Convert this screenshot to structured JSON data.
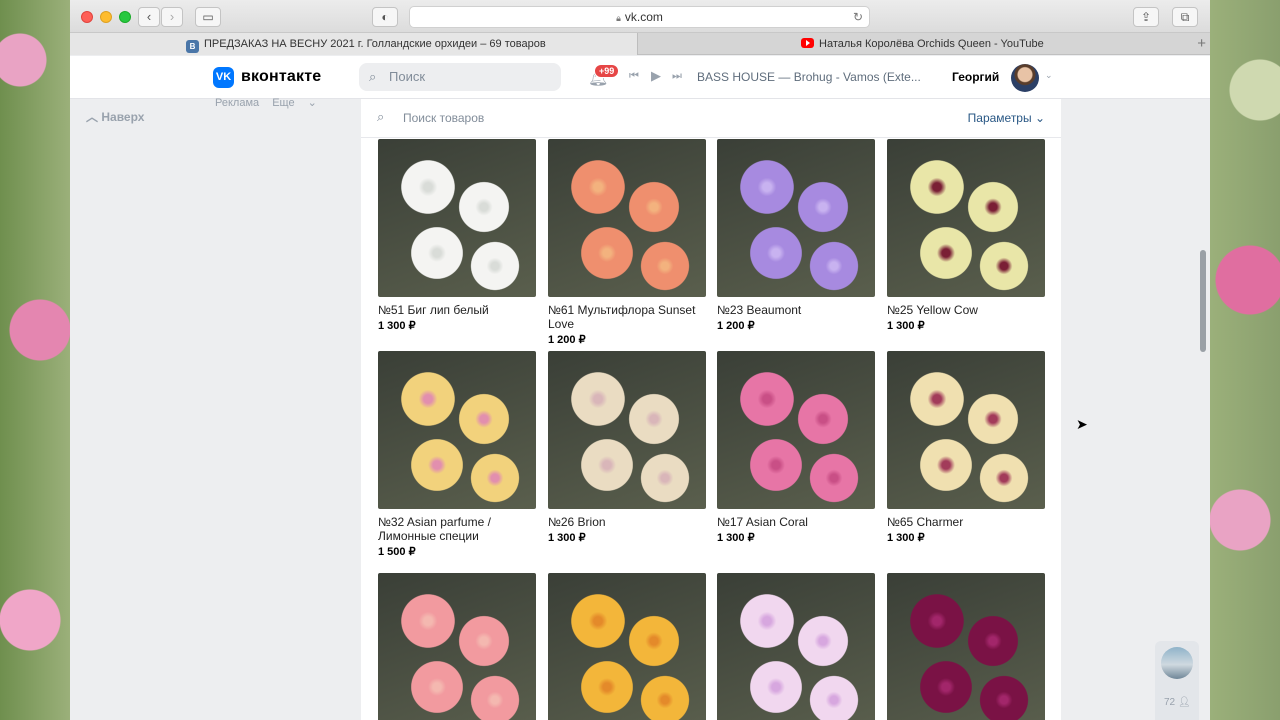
{
  "browser": {
    "url": "vk.com",
    "tabs": [
      {
        "title": "ПРЕДЗАКАЗ НА ВЕСНУ 2021 г. Голландские орхидеи – 69 товаров",
        "favicon": "vk-icon"
      },
      {
        "title": "Наталья Королёва Orchids Queen - YouTube",
        "favicon": "youtube-icon"
      }
    ],
    "new_tab_label": "+"
  },
  "vk": {
    "logo_text": "вконтакте",
    "search_placeholder": "Поиск",
    "notifications_badge": "+99",
    "track": "BASS HOUSE — Brohug - Vamos (Exte...",
    "user_name": "Георгий",
    "sidebar_links": [
      "Реклама",
      "Еще"
    ],
    "back_to_top": "Наверх"
  },
  "market": {
    "search_placeholder": "Поиск товаров",
    "params_label": "Параметры"
  },
  "products": [
    {
      "title": "№51 Биг лип белый",
      "price": "1 300 ₽",
      "colors": [
        "#f4f4f2",
        "#d9dcd8"
      ]
    },
    {
      "title": "№61 Мультифлора Sunset Love",
      "price": "1 200 ₽",
      "colors": [
        "#ef8f6e",
        "#f3b27e"
      ]
    },
    {
      "title": "№23 Beaumont",
      "price": "1 200 ₽",
      "colors": [
        "#a78ae0",
        "#c8b2f0"
      ]
    },
    {
      "title": "№25 Yellow Cow",
      "price": "1 300 ₽",
      "colors": [
        "#e9e6a8",
        "#7a1f35"
      ]
    },
    {
      "title": "№32 Asian parfume / Лимонные специи",
      "price": "1 500 ₽",
      "colors": [
        "#f2d27c",
        "#e28fae"
      ]
    },
    {
      "title": "№26 Brion",
      "price": "1 300 ₽",
      "colors": [
        "#eadcc2",
        "#d9b6b9"
      ]
    },
    {
      "title": "№17 Asian Coral",
      "price": "1 300 ₽",
      "colors": [
        "#e775a6",
        "#c94f86"
      ]
    },
    {
      "title": "№65 Charmer",
      "price": "1 300 ₽",
      "colors": [
        "#f0e0b0",
        "#a23b5a"
      ]
    },
    {
      "title": "",
      "price": "",
      "colors": [
        "#f29a9f",
        "#f4b8b0"
      ]
    },
    {
      "title": "",
      "price": "",
      "colors": [
        "#f3b63a",
        "#e48a2a"
      ]
    },
    {
      "title": "",
      "price": "",
      "colors": [
        "#f1d7ef",
        "#d7a7df"
      ]
    },
    {
      "title": "",
      "price": "",
      "colors": [
        "#7a1245",
        "#a2266a"
      ]
    }
  ],
  "chat_widget": {
    "count": "72"
  }
}
